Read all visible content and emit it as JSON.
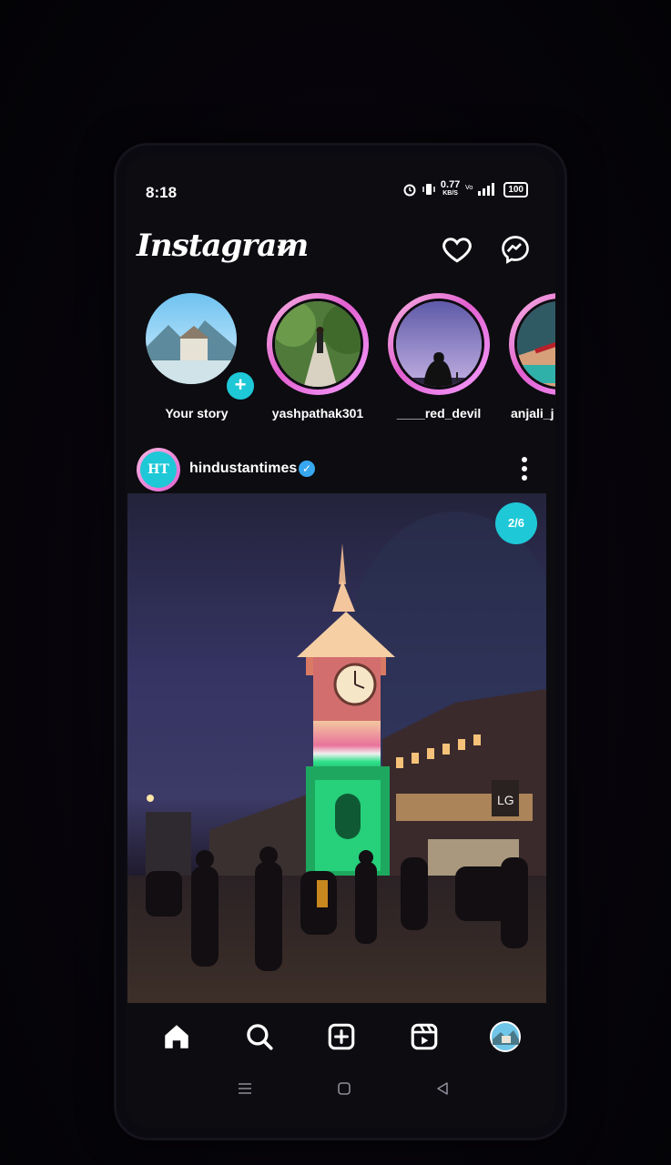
{
  "status_bar": {
    "time": "8:18",
    "net_speed": "0.77",
    "net_unit": "KB/S",
    "battery": "100"
  },
  "header": {
    "logo": "Instagram",
    "icons": [
      "chevron-down-icon",
      "heart-icon",
      "messenger-icon"
    ]
  },
  "stories": [
    {
      "name": "Your story"
    },
    {
      "name": "yashpathak301"
    },
    {
      "name": "____red_devil"
    },
    {
      "name": "anjali_j"
    }
  ],
  "post": {
    "username": "hindustantimes",
    "avatar_text": "HT",
    "page_indicator": "2/6",
    "image_sign": "LG"
  },
  "bottom_nav": [
    "home-icon",
    "search-icon",
    "new-post-icon",
    "reels-icon",
    "profile-avatar"
  ],
  "colors": {
    "accent": "#1ec8d7",
    "story_ring": "#e25fd0",
    "verified": "#37a7f0",
    "background": "#0d0c11"
  }
}
